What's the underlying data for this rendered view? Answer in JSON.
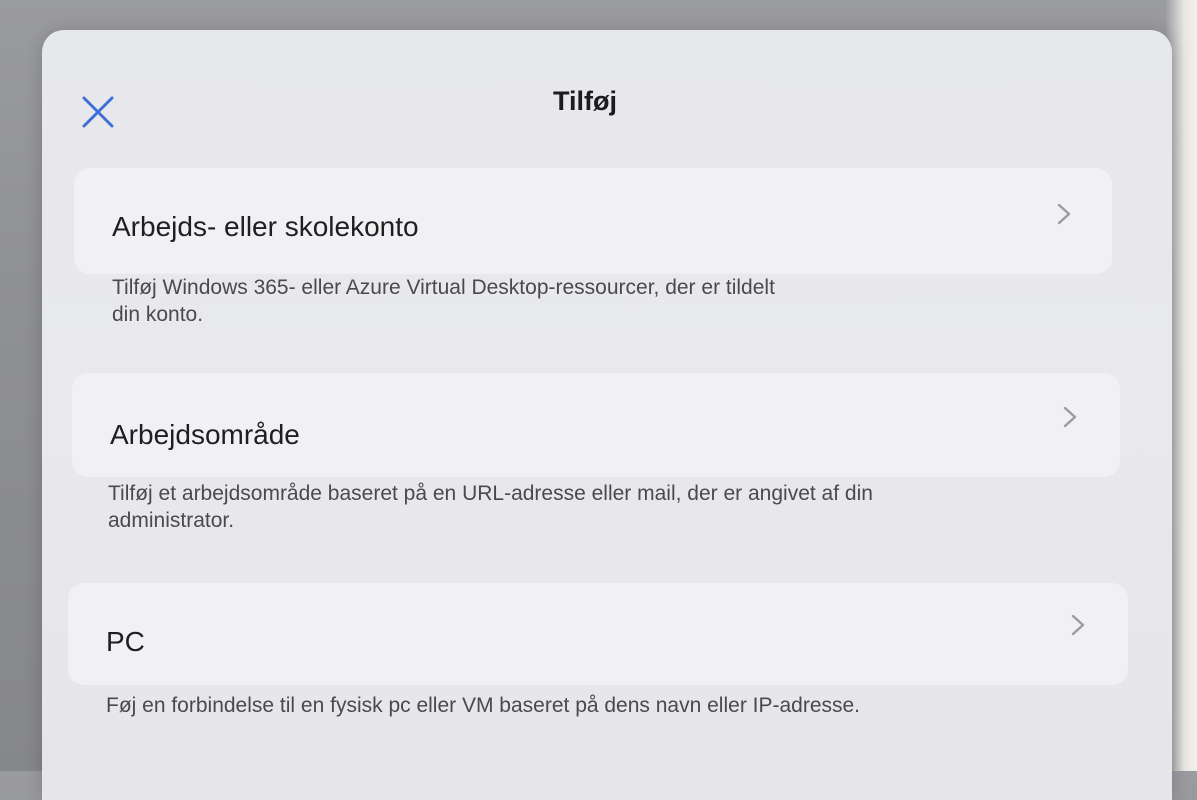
{
  "sheet": {
    "title": "Tilføj",
    "close_icon": "close-icon",
    "accent_color": "#3f6fd6"
  },
  "options": [
    {
      "label": "Arbejds- eller skolekonto",
      "description_line1": "Tilføj Windows 365- eller Azure Virtual Desktop-ressourcer, der er tildelt",
      "description_line2": "din konto.",
      "icon": "chevron-right-icon"
    },
    {
      "label": "Arbejdsområde",
      "description_line1": "Tilføj et arbejdsområde baseret på en URL-adresse eller mail, der er angivet af din",
      "description_line2": "administrator.",
      "icon": "chevron-right-icon"
    },
    {
      "label": "PC",
      "description_line1": "Føj en forbindelse til en fysisk pc eller VM baseret på dens navn eller IP-adresse.",
      "icon": "chevron-right-icon"
    }
  ]
}
